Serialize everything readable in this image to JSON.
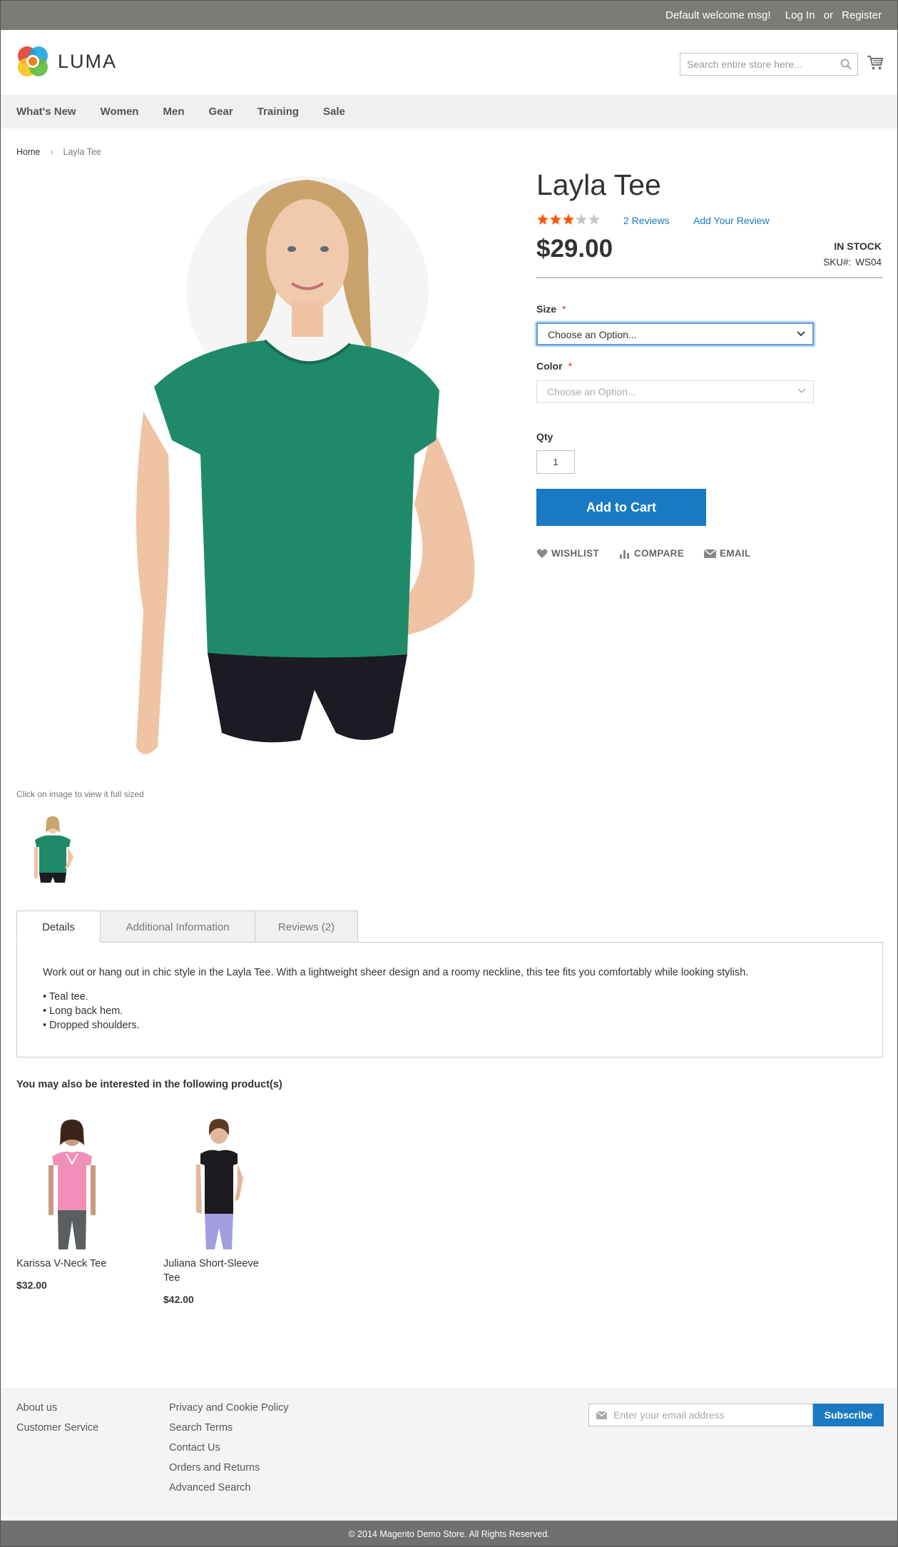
{
  "header": {
    "welcome": "Default welcome msg!",
    "login": "Log In",
    "or": "or",
    "register": "Register",
    "logo_text": "LUMA",
    "search_placeholder": "Search entire store here..."
  },
  "nav": {
    "items": [
      {
        "label": "What's New"
      },
      {
        "label": "Women"
      },
      {
        "label": "Men"
      },
      {
        "label": "Gear"
      },
      {
        "label": "Training"
      },
      {
        "label": "Sale"
      }
    ]
  },
  "breadcrumb": {
    "home": "Home",
    "current": "Layla Tee"
  },
  "product": {
    "name": "Layla Tee",
    "rating": 3,
    "rating_max": 5,
    "reviews_link": "2 Reviews",
    "add_review": "Add Your Review",
    "price": "$29.00",
    "stock": "IN STOCK",
    "sku_label": "SKU#:",
    "sku_value": "WS04",
    "size_label": "Size",
    "size_value": "Choose an Option...",
    "color_label": "Color",
    "color_value": "Choose an Option...",
    "required_mark": "*",
    "qty_label": "Qty",
    "qty_value": "1",
    "add_to_cart": "Add to Cart",
    "wishlist": "WISHLIST",
    "compare": "COMPARE",
    "email": "EMAIL",
    "image_note": "Click on image to view it full sized"
  },
  "tabs": {
    "items": [
      {
        "label": "Details"
      },
      {
        "label": "Additional Information"
      },
      {
        "label": "Reviews (2)"
      }
    ],
    "details_text": "Work out or hang out in chic style in the Layla Tee. With a lightweight sheer design and a roomy neckline, this tee fits you comfortably while looking stylish.",
    "details_bullets": [
      "• Teal tee.",
      "• Long back hem.",
      "• Dropped shoulders."
    ]
  },
  "related": {
    "title": "You may also be interested in the following product(s)",
    "products": [
      {
        "name": "Karissa V-Neck Tee",
        "price": "$32.00"
      },
      {
        "name": "Juliana Short-Sleeve Tee",
        "price": "$42.00"
      }
    ]
  },
  "footer": {
    "col1": [
      "About us",
      "Customer Service"
    ],
    "col2": [
      "Privacy and Cookie Policy",
      "Search Terms",
      "Contact Us",
      "Orders and Returns",
      "Advanced Search"
    ],
    "newsletter_placeholder": "Enter your email address",
    "subscribe": "Subscribe",
    "copyright": "© 2014 Magento Demo Store. All Rights Reserved."
  },
  "colors": {
    "accent": "#1979c3",
    "star_on": "#ff5501",
    "star_off": "#c7c7c7",
    "required": "#e02b27",
    "shirt_teal": "#1e8a6a"
  }
}
